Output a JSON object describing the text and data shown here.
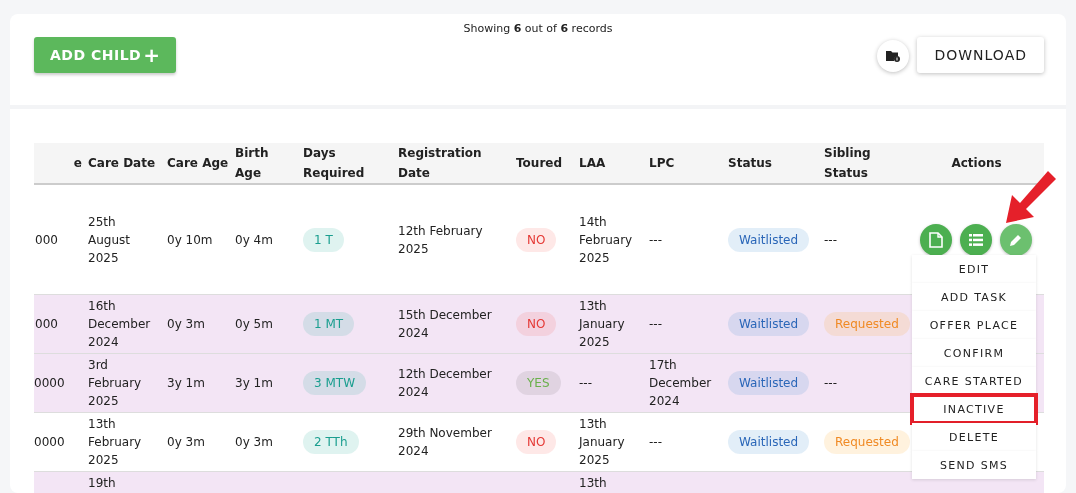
{
  "toolbar": {
    "add_button": "ADD CHILD",
    "add_icon": "+",
    "records_text": "Showing **6** out of **6** records",
    "download_button": "DOWNLOAD"
  },
  "table": {
    "columns": [
      "e",
      "Care Date",
      "Care Age",
      "Birth Age",
      "Days Required",
      "Registration Date",
      "Toured",
      "LAA",
      "LPC",
      "Status",
      "Sibling Status",
      "Actions"
    ],
    "rows": [
      {
        "highlighted": false,
        "column_1": "000",
        "care_date": "25th August 2025",
        "care_age": "0y 10m",
        "birth_age": "0y 4m",
        "days_required": "1 T",
        "registration_date": "12th February 2025",
        "toured": {
          "text": "NO",
          "positive": false
        },
        "laa": "14th February 2025",
        "lpc": "---",
        "status": "Waitlisted",
        "sibling_status": {
          "text": "---",
          "kind": "plain"
        },
        "actions": true
      },
      {
        "highlighted": true,
        "column_1": "000",
        "care_date": "16th December 2024",
        "care_age": "0y 3m",
        "birth_age": "0y 5m",
        "days_required": "1 MT",
        "registration_date": "15th December 2024",
        "toured": {
          "text": "NO",
          "positive": false
        },
        "laa": "13th January 2025",
        "lpc": "---",
        "status": "Waitlisted",
        "sibling_status": {
          "text": "Requested",
          "kind": "pill"
        },
        "actions": false
      },
      {
        "highlighted": true,
        "column_1": "0000",
        "care_date": "3rd February 2025",
        "care_age": "3y 1m",
        "birth_age": "3y 1m",
        "days_required": "3 MTW",
        "registration_date": "12th December 2024",
        "toured": {
          "text": "YES",
          "positive": true
        },
        "laa": "---",
        "lpc": "17th December 2024",
        "status": "Waitlisted",
        "sibling_status": {
          "text": "---",
          "kind": "plain"
        },
        "actions": false
      },
      {
        "highlighted": false,
        "column_1": "0000",
        "care_date": "13th February 2025",
        "care_age": "0y 3m",
        "birth_age": "0y 3m",
        "days_required": "2 TTh",
        "registration_date": "29th November 2024",
        "toured": {
          "text": "NO",
          "positive": false
        },
        "laa": "13th January 2025",
        "lpc": "---",
        "status": "Waitlisted",
        "sibling_status": {
          "text": "Requested",
          "kind": "pill"
        },
        "actions": false
      },
      {
        "highlighted": true,
        "care_date": "19th",
        "laa": "13th",
        "actions": false
      }
    ]
  },
  "action_menu": [
    {
      "label": "EDIT",
      "highlighted": false
    },
    {
      "label": "ADD TASK",
      "highlighted": false
    },
    {
      "label": "OFFER PLACE",
      "highlighted": false
    },
    {
      "label": "CONFIRM",
      "highlighted": false
    },
    {
      "label": "CARE STARTED",
      "highlighted": false
    },
    {
      "label": "INACTIVE",
      "highlighted": true
    },
    {
      "label": "DELETE",
      "highlighted": false
    },
    {
      "label": "SEND SMS",
      "highlighted": false
    }
  ]
}
